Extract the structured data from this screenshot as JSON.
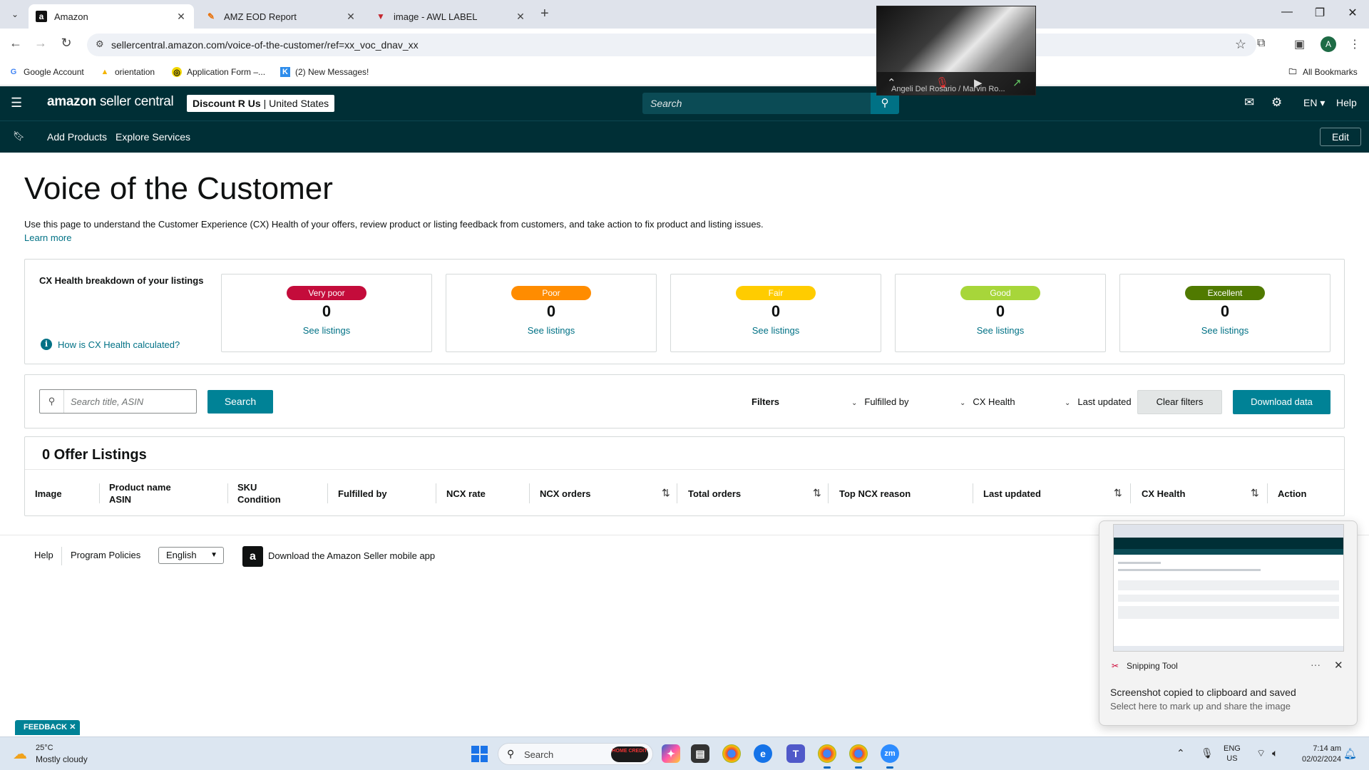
{
  "browser": {
    "tabs": [
      {
        "label": "Amazon",
        "favicon": "a",
        "active": true
      },
      {
        "label": "AMZ EOD Report",
        "favicon": "✎",
        "active": false
      },
      {
        "label": "image - AWL LABEL",
        "favicon": "▼",
        "active": false
      }
    ],
    "url": "sellercentral.amazon.com/voice-of-the-customer/ref=xx_voc_dnav_xx",
    "bookmarks": [
      {
        "label": "Google Account",
        "icon": "G"
      },
      {
        "label": "orientation",
        "icon": "▲"
      },
      {
        "label": "Application Form –...",
        "icon": "◎"
      },
      {
        "label": "(2) New Messages!",
        "icon": "K"
      }
    ],
    "all_bookmarks": "All Bookmarks",
    "profile_initial": "A"
  },
  "video_call": {
    "participant": "Angeli Del Rosario / Marvin Ro..."
  },
  "header": {
    "logo_main": "amazon",
    "logo_sub": "seller central",
    "store_name": "Discount R Us",
    "store_market": "United States",
    "search_placeholder": "Search",
    "language": "EN",
    "help": "Help",
    "nav": [
      "Add Products",
      "Explore Services"
    ],
    "edit": "Edit"
  },
  "page": {
    "title": "Voice of the Customer",
    "description": "Use this page to understand the Customer Experience (CX) Health of your offers, review product or listing feedback from customers, and take action to fix product and listing issues.",
    "learn_more": "Learn more"
  },
  "cx_health": {
    "label": "CX Health breakdown of your listings",
    "how_link": "How is CX Health calculated?",
    "cards": [
      {
        "rating": "Very poor",
        "count": "0",
        "link": "See listings",
        "color": "#c40c3b",
        "text_color": "#ffffff"
      },
      {
        "rating": "Poor",
        "count": "0",
        "link": "See listings",
        "color": "#ff8c00",
        "text_color": "#ffffff"
      },
      {
        "rating": "Fair",
        "count": "0",
        "link": "See listings",
        "color": "#ffcc00",
        "text_color": "#ffffff"
      },
      {
        "rating": "Good",
        "count": "0",
        "link": "See listings",
        "color": "#a7d63a",
        "text_color": "#ffffff"
      },
      {
        "rating": "Excellent",
        "count": "0",
        "link": "See listings",
        "color": "#507a00",
        "text_color": "#ffffff"
      }
    ]
  },
  "filters": {
    "search_placeholder": "Search title, ASIN",
    "search_button": "Search",
    "label": "Filters",
    "dropdowns": [
      "Fulfilled by",
      "CX Health",
      "Last updated"
    ],
    "clear": "Clear filters",
    "download": "Download data"
  },
  "listings": {
    "title": "0 Offer Listings",
    "columns": [
      {
        "l1": "Image",
        "l2": ""
      },
      {
        "l1": "Product name",
        "l2": "ASIN"
      },
      {
        "l1": "SKU",
        "l2": "Condition"
      },
      {
        "l1": "Fulfilled by",
        "l2": ""
      },
      {
        "l1": "NCX rate",
        "l2": ""
      },
      {
        "l1": "NCX orders",
        "l2": ""
      },
      {
        "l1": "Total orders",
        "l2": ""
      },
      {
        "l1": "Top NCX reason",
        "l2": ""
      },
      {
        "l1": "Last updated",
        "l2": ""
      },
      {
        "l1": "CX Health",
        "l2": ""
      },
      {
        "l1": "Action",
        "l2": ""
      }
    ]
  },
  "footer": {
    "links": [
      "Help",
      "Program Policies"
    ],
    "language": "English",
    "app_text": "Download the Amazon Seller mobile app",
    "feedback": "FEEDBACK"
  },
  "toast": {
    "app": "Snipping Tool",
    "heading": "Screenshot copied to clipboard and saved",
    "sub": "Select here to mark up and share the image"
  },
  "taskbar": {
    "temp": "25°C",
    "weather": "Mostly cloudy",
    "search": "Search",
    "search_badge": "HOME CREDIT",
    "lang_top": "ENG",
    "lang_bottom": "US",
    "time": "7:14 am",
    "date": "02/02/2024"
  }
}
